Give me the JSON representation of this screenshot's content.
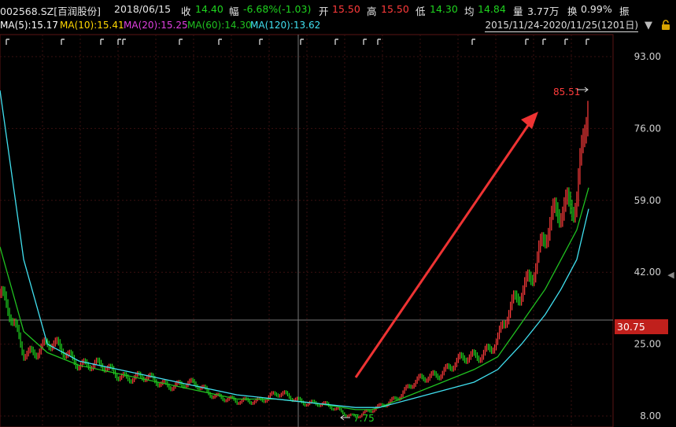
{
  "header": {
    "code": "002568.SZ[百润股份]",
    "date": "2018/06/15",
    "close_label": "收",
    "close_value": "14.40",
    "change_label": "幅",
    "change_value": "-6.68%(-1.03)",
    "open_label": "开",
    "open_value": "15.50",
    "high_label": "高",
    "high_value": "15.50",
    "low_label": "低",
    "low_value": "14.30",
    "avg_label": "均",
    "avg_value": "14.84",
    "volume_label": "量",
    "volume_value": "3.77万",
    "turnover_label": "换",
    "turnover_value": "0.99%",
    "amplitude_label": "振"
  },
  "ma_legend": {
    "ma5": "MA(5):15.17",
    "ma10": "MA(10):15.41",
    "ma20": "MA(20):15.25",
    "ma60": "MA(60):14.30",
    "ma120": "MA(120):13.62"
  },
  "range_label": "2015/11/24-2020/11/25(1201日)",
  "current_price_tag": "30.75",
  "colors": {
    "up": "#ff3b3b",
    "down": "#1fd31f",
    "ma5": "#ffffff",
    "ma10": "#ffd700",
    "ma20": "#e040e0",
    "ma60": "#20c020",
    "ma120": "#40e0f0",
    "arrow": "#ee3333",
    "grid": "#3a1010",
    "background": "#000000"
  },
  "chart_data": {
    "type": "line",
    "title": "",
    "xlabel": "",
    "ylabel": "",
    "ylim": [
      8.0,
      93.0
    ],
    "y_ticks": [
      "93.00",
      "76.00",
      "59.00",
      "42.00",
      "25.00",
      "8.00"
    ],
    "annotations": {
      "high": "85.51",
      "low": "7.75"
    },
    "x": [
      0,
      30,
      60,
      100,
      150,
      200,
      250,
      300,
      350,
      400,
      450,
      470,
      480,
      520,
      560,
      600,
      630,
      660,
      690,
      710,
      730,
      745
    ],
    "series": [
      {
        "name": "price",
        "values": [
          37,
          23,
          25,
          21,
          18,
          16,
          15,
          11,
          13,
          11,
          8,
          9,
          10,
          15,
          19,
          22,
          26,
          38,
          50,
          56,
          62,
          85
        ]
      },
      {
        "name": "MA(60)",
        "values": [
          48,
          28,
          23,
          20,
          18,
          16,
          14,
          12,
          12,
          11,
          9.5,
          9.5,
          10,
          13,
          16,
          19,
          22,
          30,
          38,
          45,
          52,
          62
        ]
      },
      {
        "name": "MA(120)",
        "values": [
          85,
          45,
          25,
          21,
          19,
          17,
          15,
          13,
          12,
          11,
          10,
          10,
          10,
          12,
          14,
          16,
          19,
          25,
          32,
          38,
          45,
          57
        ]
      }
    ]
  }
}
